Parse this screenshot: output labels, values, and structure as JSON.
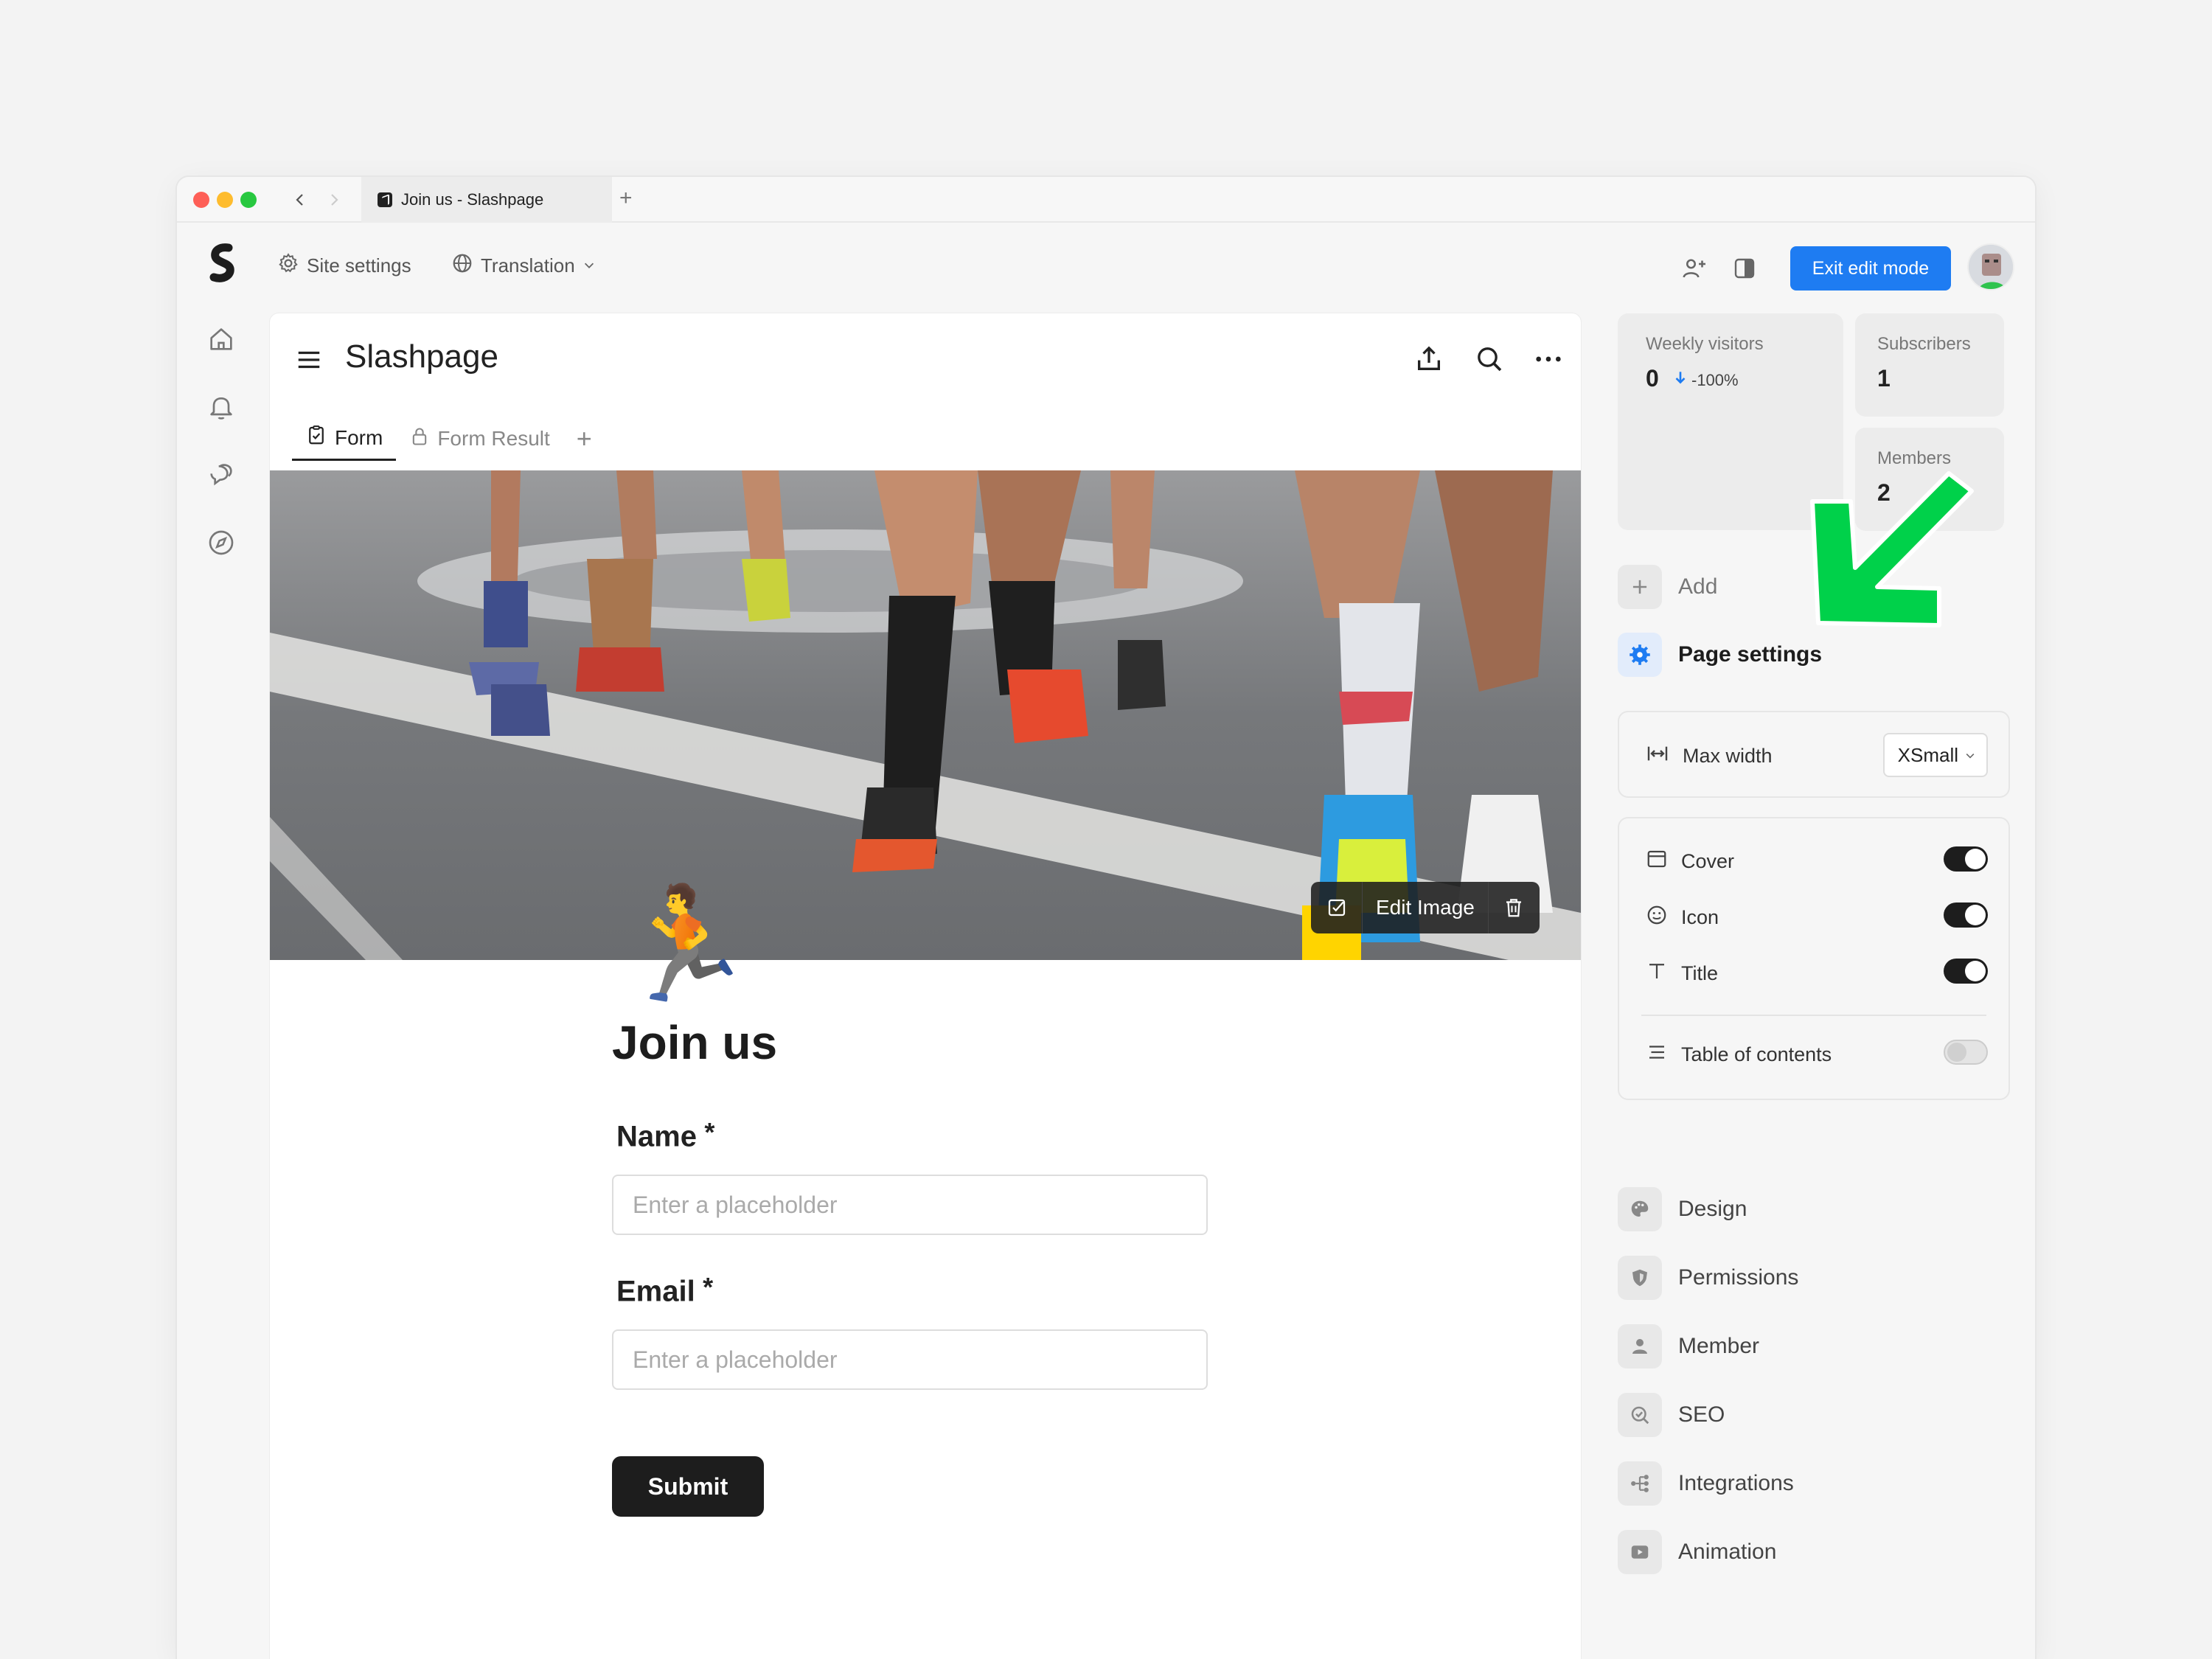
{
  "browser": {
    "tab_title": "Join us - Slashpage",
    "new_tab": "+"
  },
  "topbar": {
    "site_settings": "Site settings",
    "translation": "Translation",
    "exit_edit": "Exit edit mode"
  },
  "page": {
    "title": "Slashpage",
    "tabs": [
      {
        "label": "Form"
      },
      {
        "label": "Form Result"
      }
    ],
    "add_tab": "+"
  },
  "cover": {
    "edit_image": "Edit Image"
  },
  "form": {
    "icon_emoji": "🏃",
    "title": "Join us",
    "fields": [
      {
        "label": "Name",
        "required": "*",
        "placeholder": "Enter a placeholder"
      },
      {
        "label": "Email",
        "required": "*",
        "placeholder": "Enter a placeholder"
      }
    ],
    "submit": "Submit"
  },
  "stats": {
    "weekly_visitors": {
      "label": "Weekly visitors",
      "value": "0",
      "change": "-100%"
    },
    "subscribers": {
      "label": "Subscribers",
      "value": "1"
    },
    "members": {
      "label": "Members",
      "value": "2"
    }
  },
  "right_panel": {
    "add": "Add",
    "page_settings": "Page settings",
    "max_width": {
      "label": "Max width",
      "value": "XSmall"
    },
    "toggles": [
      {
        "label": "Cover",
        "on": true
      },
      {
        "label": "Icon",
        "on": true
      },
      {
        "label": "Title",
        "on": true
      },
      {
        "label": "Table of contents",
        "on": false
      }
    ],
    "menu": [
      {
        "label": "Design",
        "icon": "palette-icon"
      },
      {
        "label": "Permissions",
        "icon": "shield-icon"
      },
      {
        "label": "Member",
        "icon": "person-icon"
      },
      {
        "label": "SEO",
        "icon": "seo-search-icon"
      },
      {
        "label": "Integrations",
        "icon": "integrations-icon"
      },
      {
        "label": "Animation",
        "icon": "play-icon"
      }
    ]
  },
  "colors": {
    "accent": "#1e7cf2",
    "annotation_arrow": "#00d14a"
  }
}
